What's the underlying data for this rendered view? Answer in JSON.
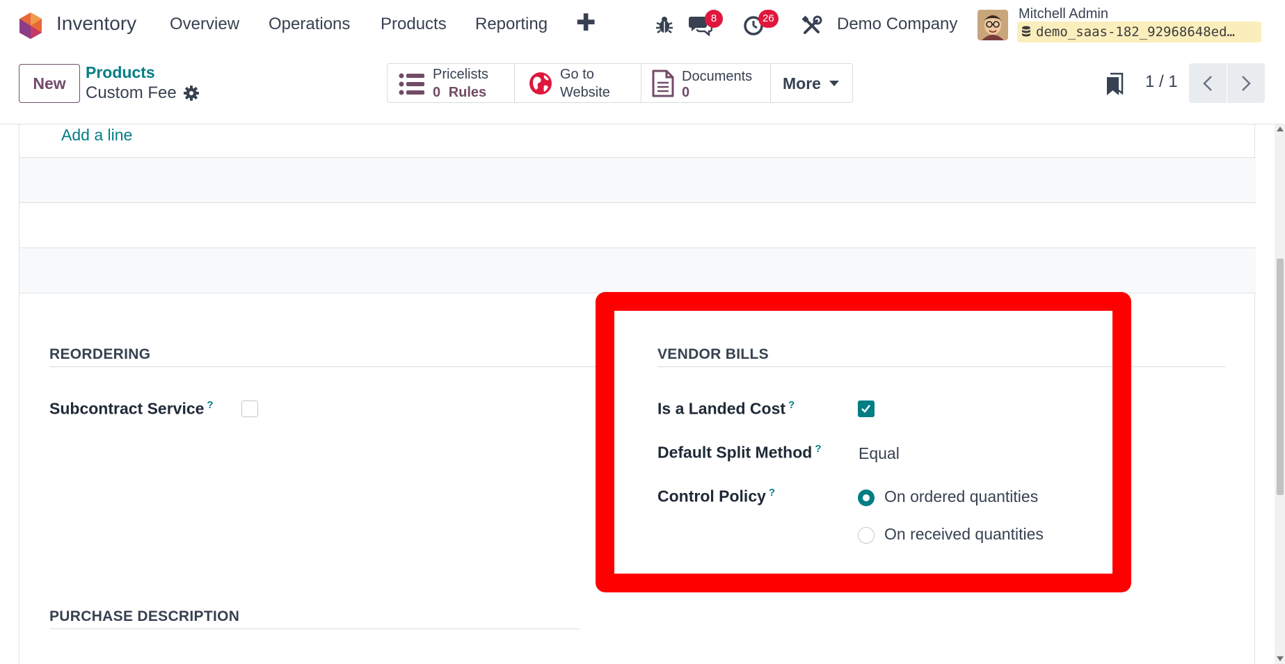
{
  "navbar": {
    "app_name": "Inventory",
    "menu": [
      "Overview",
      "Operations",
      "Products",
      "Reporting"
    ],
    "plus": "✚",
    "messages_count": "8",
    "activities_count": "26",
    "company": "Demo Company",
    "user_name": "Mitchell Admin",
    "database": "demo_saas-182_92968648ed…",
    "badge_color": "#e0173d"
  },
  "control_panel": {
    "new_label": "New",
    "breadcrumb_parent": "Products",
    "record_title": "Custom Fee",
    "smart_buttons": {
      "pricelists": {
        "label": "Pricelists",
        "count": "0",
        "sublabel": "Rules"
      },
      "website": {
        "line1": "Go to",
        "line2": "Website"
      },
      "documents": {
        "label": "Documents",
        "count": "0"
      },
      "more": "More"
    },
    "pager": "1 / 1"
  },
  "form": {
    "add_line": "Add a line",
    "reordering": {
      "title": "REORDERING",
      "subcontract_label": "Subcontract Service",
      "subcontract_checked": false
    },
    "vendor_bills": {
      "title": "VENDOR BILLS",
      "landed_cost_label": "Is a Landed Cost",
      "landed_cost_checked": true,
      "split_method_label": "Default Split Method",
      "split_method_value": "Equal",
      "control_policy_label": "Control Policy",
      "control_policy_options": [
        "On ordered quantities",
        "On received quantities"
      ],
      "control_policy_selected": "On ordered quantities"
    },
    "purchase_description": {
      "title": "PURCHASE DESCRIPTION"
    },
    "help_mark": "?"
  },
  "colors": {
    "primary": "#714b67",
    "accent": "#017e84",
    "highlight": "#ff0000"
  }
}
